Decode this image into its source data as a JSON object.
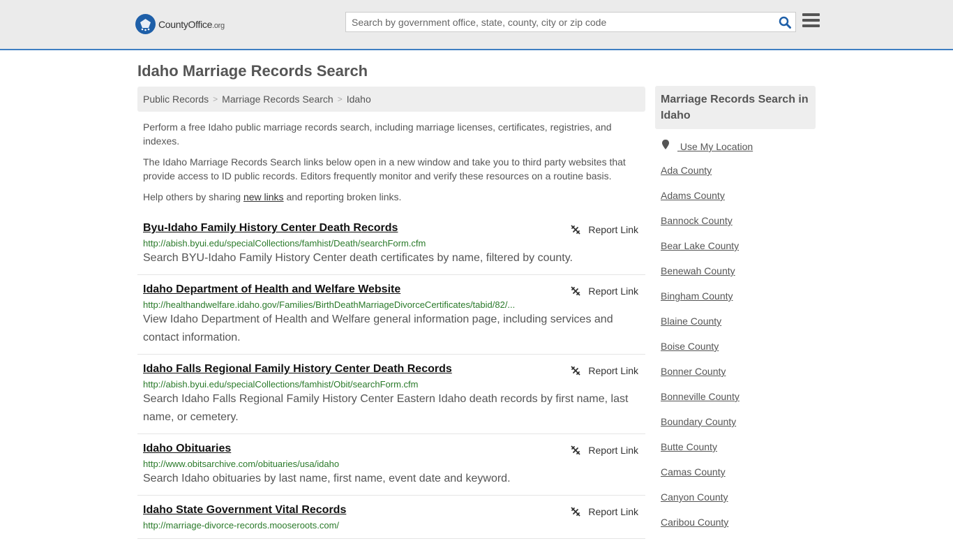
{
  "header": {
    "logo_text": "CountyOffice",
    "logo_suffix": ".org",
    "search_placeholder": "Search by government office, state, county, city or zip code"
  },
  "page_title": "Idaho Marriage Records Search",
  "breadcrumb": [
    "Public Records",
    "Marriage Records Search",
    "Idaho"
  ],
  "intro": {
    "p1": "Perform a free Idaho public marriage records search, including marriage licenses, certificates, registries, and indexes.",
    "p2": "The Idaho Marriage Records Search links below open in a new window and take you to third party websites that provide access to ID public records. Editors frequently monitor and verify these resources on a routine basis.",
    "p3_pre": "Help others by sharing ",
    "p3_link": "new links",
    "p3_post": " and reporting broken links."
  },
  "report_label": "Report Link",
  "links": [
    {
      "title": "Byu-Idaho Family History Center Death Records",
      "url": "http://abish.byui.edu/specialCollections/famhist/Death/searchForm.cfm",
      "desc": "Search BYU-Idaho Family History Center death certificates by name, filtered by county."
    },
    {
      "title": "Idaho Department of Health and Welfare Website",
      "url": "http://healthandwelfare.idaho.gov/Families/BirthDeathMarriageDivorceCertificates/tabid/82/...",
      "desc": "View Idaho Department of Health and Welfare general information page, including services and contact information."
    },
    {
      "title": "Idaho Falls Regional Family History Center Death Records",
      "url": "http://abish.byui.edu/specialCollections/famhist/Obit/searchForm.cfm",
      "desc": "Search Idaho Falls Regional Family History Center Eastern Idaho death records by first name, last name, or cemetery."
    },
    {
      "title": "Idaho Obituaries",
      "url": "http://www.obitsarchive.com/obituaries/usa/idaho",
      "desc": "Search Idaho obituaries by last name, first name, event date and keyword."
    },
    {
      "title": "Idaho State Government Vital Records",
      "url": "http://marriage-divorce-records.mooseroots.com/",
      "desc": ""
    }
  ],
  "sidebar": {
    "heading": "Marriage Records Search in Idaho",
    "location_label": "Use My Location",
    "counties": [
      "Ada County",
      "Adams County",
      "Bannock County",
      "Bear Lake County",
      "Benewah County",
      "Bingham County",
      "Blaine County",
      "Boise County",
      "Bonner County",
      "Bonneville County",
      "Boundary County",
      "Butte County",
      "Camas County",
      "Canyon County",
      "Caribou County"
    ]
  }
}
